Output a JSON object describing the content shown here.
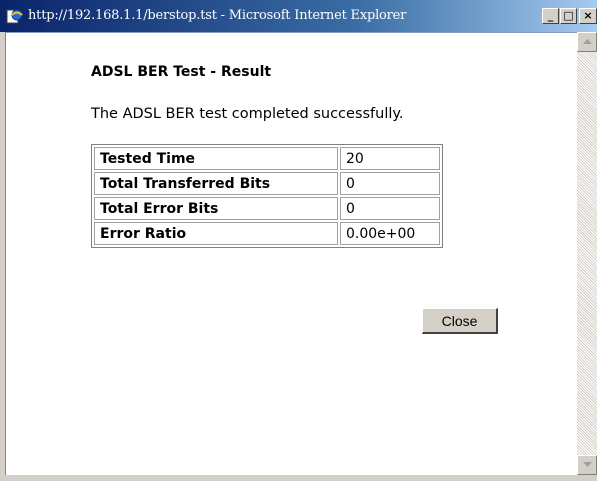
{
  "window": {
    "title": "http://192.168.1.1/berstop.tst - Microsoft Internet Explorer",
    "minimize_glyph": "_",
    "maximize_glyph": "□",
    "close_glyph": "×",
    "icon": "ie-page-icon"
  },
  "page": {
    "heading": "ADSL BER Test - Result",
    "message": "The ADSL BER test completed successfully.",
    "rows": [
      {
        "label": "Tested Time",
        "value": "20"
      },
      {
        "label": "Total Transferred Bits",
        "value": "0"
      },
      {
        "label": "Total Error Bits",
        "value": "0"
      },
      {
        "label": "Error Ratio",
        "value": "0.00e+00"
      }
    ],
    "close_label": "Close"
  },
  "colors": {
    "titlebar_start": "#0a246a",
    "titlebar_end": "#a6caf0",
    "button_face": "#d4d0c8"
  }
}
